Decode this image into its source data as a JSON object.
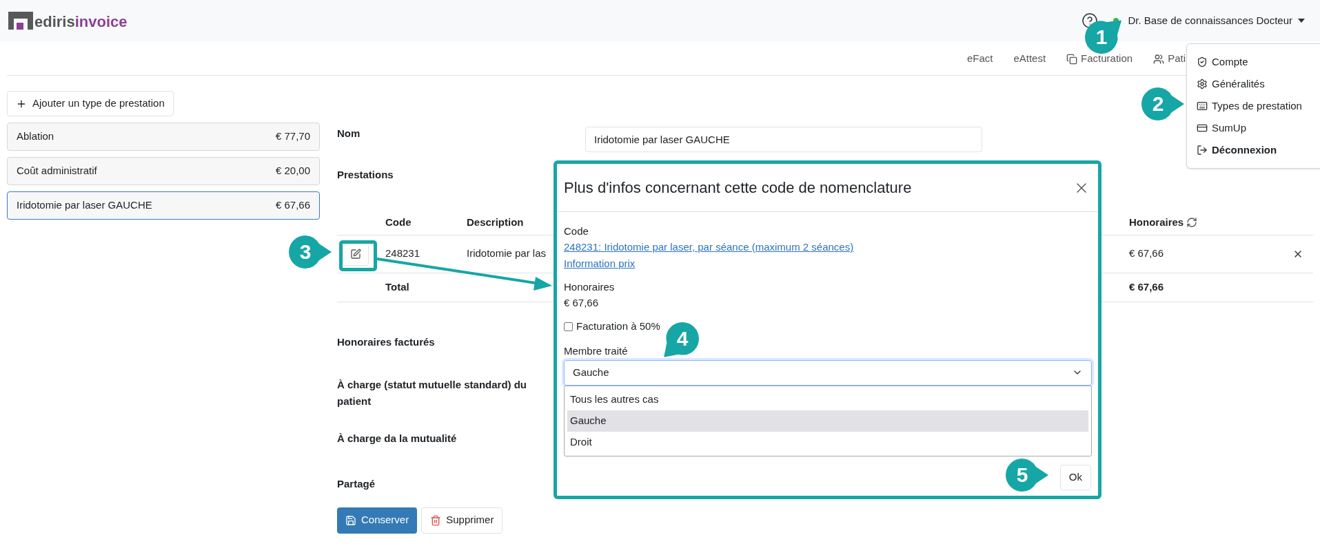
{
  "header": {
    "logo": {
      "text_1": "ediris",
      "text_2": "invoice"
    },
    "online": true,
    "user": "Dr. Base de connaissances Docteur"
  },
  "nav": [
    {
      "label": "eFact"
    },
    {
      "label": "eAttest"
    },
    {
      "label": "Facturation"
    },
    {
      "label": "Pati"
    }
  ],
  "user_menu": [
    {
      "label": "Compte",
      "bold": false
    },
    {
      "label": "Généralités",
      "bold": false
    },
    {
      "label": "Types de prestation",
      "bold": false
    },
    {
      "label": "SumUp",
      "bold": false
    },
    {
      "label": "Déconnexion",
      "bold": true
    }
  ],
  "sidebar": {
    "add_button": "Ajouter un type de prestation",
    "items": [
      {
        "name": "Ablation",
        "price": "€ 77,70",
        "selected": false
      },
      {
        "name": "Coût administratif",
        "price": "€ 20,00",
        "selected": false
      },
      {
        "name": "Iridotomie par laser GAUCHE",
        "price": "€ 67,66",
        "selected": true
      }
    ]
  },
  "form": {
    "name_label": "Nom",
    "name_value": "Iridotomie par laser GAUCHE",
    "prestations_label": "Prestations",
    "table": {
      "columns": [
        "Code",
        "Description",
        "Honoraires"
      ],
      "rows": [
        {
          "code": "248231",
          "description": "Iridotomie par las",
          "fee": "€ 67,66"
        }
      ],
      "total_label": "Total",
      "total_value": "€ 67,66"
    },
    "sections": [
      "Honoraires facturés",
      "À charge (statut mutuelle standard) du patient",
      "À charge da la mutualité",
      "Partagé"
    ],
    "save_button": "Conserver",
    "delete_button": "Supprimer"
  },
  "modal": {
    "title": "Plus d'infos concernant cette code de nomenclature",
    "code_label": "Code",
    "code_link": "248231: Iridotomie par laser, par séance (maximum 2 séances)",
    "price_link": "Information prix",
    "fee_label": "Honoraires",
    "fee_value": "€ 67,66",
    "checkbox": {
      "label": "Facturation à 50%",
      "checked": false
    },
    "select": {
      "label": "Membre traité",
      "value": "Gauche",
      "expanded": true,
      "options": [
        {
          "label": "Tous les autres cas",
          "selected": false
        },
        {
          "label": "Gauche",
          "selected": true
        },
        {
          "label": "Droit",
          "selected": false
        }
      ]
    },
    "ok_button": "Ok"
  },
  "annotations": [
    "1",
    "2",
    "3",
    "4",
    "5"
  ]
}
